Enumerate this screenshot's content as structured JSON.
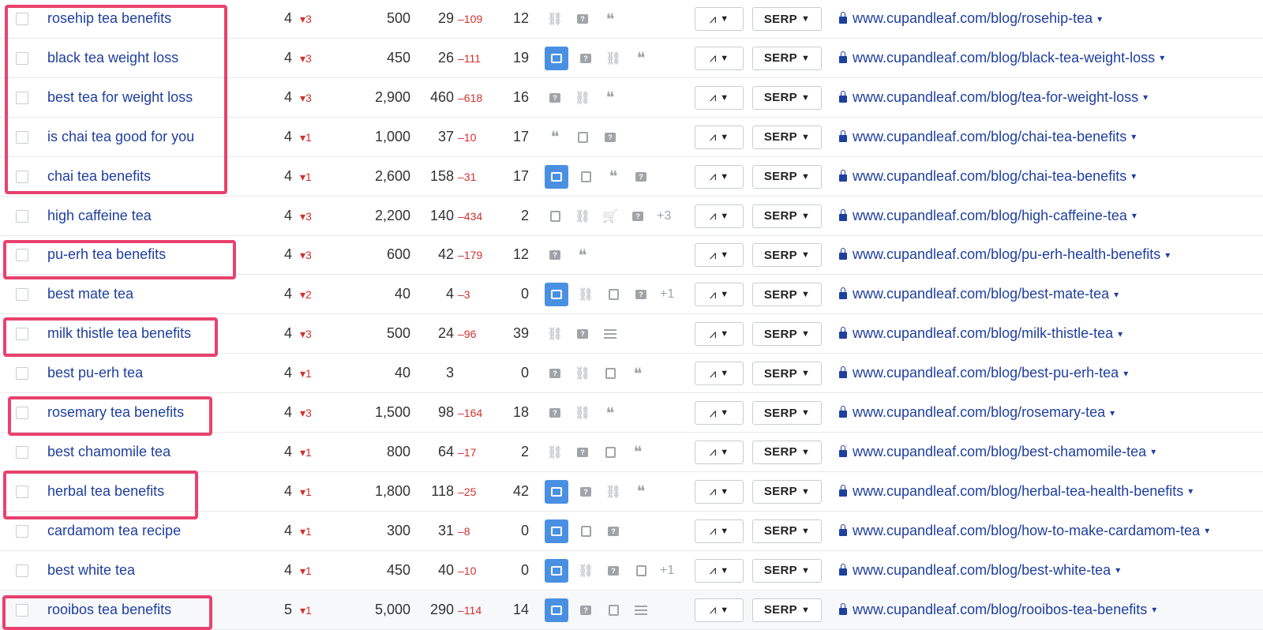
{
  "columns_hidden": true,
  "rows": [
    {
      "keyword": "rosehip tea benefits",
      "position": "4",
      "change": "3",
      "volume": "500",
      "traffic": "29",
      "traffic_change": "–109",
      "kd": "12",
      "features": [
        "link",
        "bubble",
        "quote"
      ],
      "more": "",
      "url": "www.cupandleaf.com/blog/rosehip-tea"
    },
    {
      "keyword": "black tea weight loss",
      "position": "4",
      "change": "3",
      "volume": "450",
      "traffic": "26",
      "traffic_change": "–111",
      "kd": "19",
      "features": [
        "image",
        "bubble",
        "link",
        "quote"
      ],
      "more": "",
      "url": "www.cupandleaf.com/blog/black-tea-weight-loss"
    },
    {
      "keyword": "best tea for weight loss",
      "position": "4",
      "change": "3",
      "volume": "2,900",
      "traffic": "460",
      "traffic_change": "–618",
      "kd": "16",
      "features": [
        "bubble",
        "link",
        "quote"
      ],
      "more": "",
      "url": "www.cupandleaf.com/blog/tea-for-weight-loss"
    },
    {
      "keyword": "is chai tea good for you",
      "position": "4",
      "change": "1",
      "volume": "1,000",
      "traffic": "37",
      "traffic_change": "–10",
      "kd": "17",
      "features": [
        "quote",
        "doc",
        "bubble"
      ],
      "more": "",
      "url": "www.cupandleaf.com/blog/chai-tea-benefits"
    },
    {
      "keyword": "chai tea benefits",
      "position": "4",
      "change": "1",
      "volume": "2,600",
      "traffic": "158",
      "traffic_change": "–31",
      "kd": "17",
      "features": [
        "image",
        "doc",
        "quote",
        "bubble"
      ],
      "more": "",
      "url": "www.cupandleaf.com/blog/chai-tea-benefits"
    },
    {
      "keyword": "high caffeine tea",
      "position": "4",
      "change": "3",
      "volume": "2,200",
      "traffic": "140",
      "traffic_change": "–434",
      "kd": "2",
      "features": [
        "image-gray",
        "link",
        "cart",
        "bubble"
      ],
      "more": "+3",
      "url": "www.cupandleaf.com/blog/high-caffeine-tea"
    },
    {
      "keyword": "pu-erh tea benefits",
      "position": "4",
      "change": "3",
      "volume": "600",
      "traffic": "42",
      "traffic_change": "–179",
      "kd": "12",
      "features": [
        "bubble",
        "quote"
      ],
      "more": "",
      "url": "www.cupandleaf.com/blog/pu-erh-health-benefits"
    },
    {
      "keyword": "best mate tea",
      "position": "4",
      "change": "2",
      "volume": "40",
      "traffic": "4",
      "traffic_change": "–3",
      "kd": "0",
      "features": [
        "image",
        "link",
        "doc",
        "bubble"
      ],
      "more": "+1",
      "url": "www.cupandleaf.com/blog/best-mate-tea"
    },
    {
      "keyword": "milk thistle tea benefits",
      "position": "4",
      "change": "3",
      "volume": "500",
      "traffic": "24",
      "traffic_change": "–96",
      "kd": "39",
      "features": [
        "link",
        "bubble",
        "lines"
      ],
      "more": "",
      "url": "www.cupandleaf.com/blog/milk-thistle-tea"
    },
    {
      "keyword": "best pu-erh tea",
      "position": "4",
      "change": "1",
      "volume": "40",
      "traffic": "3",
      "traffic_change": "",
      "kd": "0",
      "features": [
        "bubble",
        "link",
        "doc",
        "quote"
      ],
      "more": "",
      "url": "www.cupandleaf.com/blog/best-pu-erh-tea"
    },
    {
      "keyword": "rosemary tea benefits",
      "position": "4",
      "change": "3",
      "volume": "1,500",
      "traffic": "98",
      "traffic_change": "–164",
      "kd": "18",
      "features": [
        "bubble",
        "link",
        "quote"
      ],
      "more": "",
      "url": "www.cupandleaf.com/blog/rosemary-tea"
    },
    {
      "keyword": "best chamomile tea",
      "position": "4",
      "change": "1",
      "volume": "800",
      "traffic": "64",
      "traffic_change": "–17",
      "kd": "2",
      "features": [
        "link",
        "bubble",
        "doc",
        "quote"
      ],
      "more": "",
      "url": "www.cupandleaf.com/blog/best-chamomile-tea"
    },
    {
      "keyword": "herbal tea benefits",
      "position": "4",
      "change": "1",
      "volume": "1,800",
      "traffic": "118",
      "traffic_change": "–25",
      "kd": "42",
      "features": [
        "image",
        "bubble",
        "link",
        "quote"
      ],
      "more": "",
      "url": "www.cupandleaf.com/blog/herbal-tea-health-benefits"
    },
    {
      "keyword": "cardamom tea recipe",
      "position": "4",
      "change": "1",
      "volume": "300",
      "traffic": "31",
      "traffic_change": "–8",
      "kd": "0",
      "features": [
        "image",
        "doc",
        "bubble"
      ],
      "more": "",
      "url": "www.cupandleaf.com/blog/how-to-make-cardamom-tea"
    },
    {
      "keyword": "best white tea",
      "position": "4",
      "change": "1",
      "volume": "450",
      "traffic": "40",
      "traffic_change": "–10",
      "kd": "0",
      "features": [
        "image",
        "link",
        "bubble",
        "doc"
      ],
      "more": "+1",
      "url": "www.cupandleaf.com/blog/best-white-tea"
    },
    {
      "keyword": "rooibos tea benefits",
      "position": "5",
      "change": "1",
      "volume": "5,000",
      "traffic": "290",
      "traffic_change": "–114",
      "kd": "14",
      "features": [
        "image",
        "bubble",
        "doc",
        "lines"
      ],
      "more": "",
      "url": "www.cupandleaf.com/blog/rooibos-tea-benefits"
    }
  ],
  "buttons": {
    "serp_label": "SERP"
  },
  "glyphs": {
    "down_triangle": "▾",
    "caret": "▼",
    "quote": "❝",
    "link": "🔗",
    "cart": "🛒",
    "chart": "〰"
  },
  "colors": {
    "link": "#1f3f9f",
    "negative": "#d0312d",
    "highlight": "#e8426f",
    "serp_image": "#4a90e2"
  }
}
